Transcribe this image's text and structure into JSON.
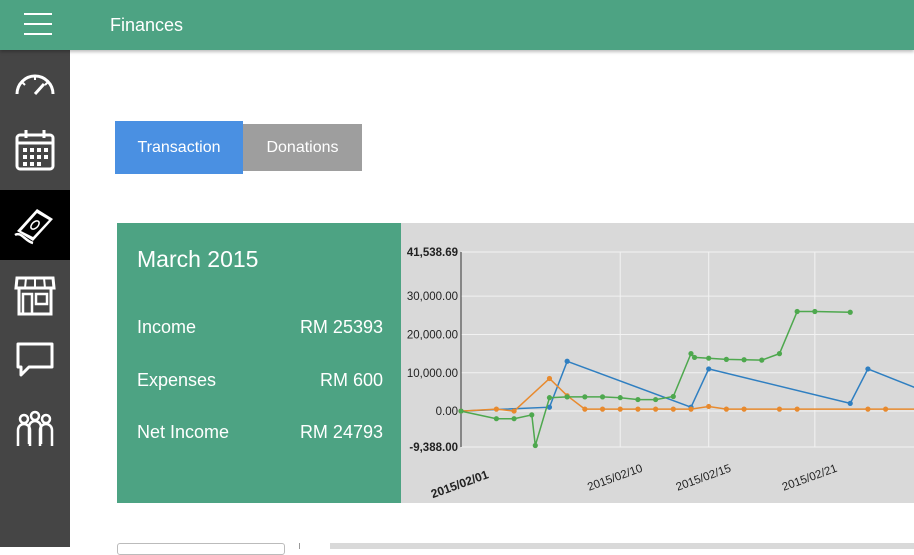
{
  "app": {
    "title": "Finances"
  },
  "sidebar": {
    "items": [
      {
        "icon": "speedometer-icon"
      },
      {
        "icon": "calendar-icon"
      },
      {
        "icon": "money-icon",
        "active": true
      },
      {
        "icon": "store-icon"
      },
      {
        "icon": "chat-icon"
      },
      {
        "icon": "people-icon"
      }
    ]
  },
  "tabs": {
    "transaction": "Transaction",
    "donations": "Donations"
  },
  "summary": {
    "month": "March 2015",
    "income_label": "Income",
    "income_value": "RM 25393",
    "expenses_label": "Expenses",
    "expenses_value": "RM 600",
    "net_label": "Net Income",
    "net_value": "RM 24793"
  },
  "chart_data": {
    "type": "line",
    "y_ticks": [
      "41,538.69",
      "30,000.00",
      "20,000.00",
      "10,000.00",
      "0.00",
      "-9,388.00"
    ],
    "x_ticks": [
      "2015/02/01",
      "2015/02/10",
      "2015/02/15",
      "2015/02/21"
    ],
    "ylim": [
      -9388,
      41538.69
    ],
    "grid": true,
    "series": [
      {
        "color": "#2f7fc1",
        "points": [
          [
            0,
            0
          ],
          [
            5,
            1000
          ],
          [
            6,
            13000
          ],
          [
            13,
            1000
          ],
          [
            14,
            11000
          ],
          [
            22,
            2000
          ],
          [
            23,
            11000
          ],
          [
            26,
            5500
          ]
        ]
      },
      {
        "color": "#e88a2e",
        "points": [
          [
            0,
            0
          ],
          [
            2,
            500
          ],
          [
            3,
            0
          ],
          [
            5,
            8500
          ],
          [
            6,
            4000
          ],
          [
            7,
            500
          ],
          [
            8,
            500
          ],
          [
            9,
            500
          ],
          [
            10,
            500
          ],
          [
            11,
            500
          ],
          [
            12,
            500
          ],
          [
            13,
            500
          ],
          [
            14,
            1200
          ],
          [
            15,
            500
          ],
          [
            16,
            500
          ],
          [
            18,
            500
          ],
          [
            19,
            500
          ],
          [
            23,
            500
          ],
          [
            24,
            500
          ],
          [
            26,
            500
          ]
        ]
      },
      {
        "color": "#4ea84e",
        "points": [
          [
            0,
            0
          ],
          [
            2,
            -2000
          ],
          [
            3,
            -2000
          ],
          [
            4,
            -1000
          ],
          [
            4.2,
            -9000
          ],
          [
            5,
            3500
          ],
          [
            6,
            3700
          ],
          [
            7,
            3700
          ],
          [
            8,
            3700
          ],
          [
            9,
            3500
          ],
          [
            10,
            3000
          ],
          [
            11,
            3000
          ],
          [
            12,
            3800
          ],
          [
            13,
            15000
          ],
          [
            13.2,
            14000
          ],
          [
            14,
            13800
          ],
          [
            15,
            13500
          ],
          [
            16,
            13400
          ],
          [
            17,
            13300
          ],
          [
            18,
            15000
          ],
          [
            19,
            26000
          ],
          [
            20,
            26000
          ],
          [
            22,
            25800
          ]
        ]
      }
    ]
  }
}
